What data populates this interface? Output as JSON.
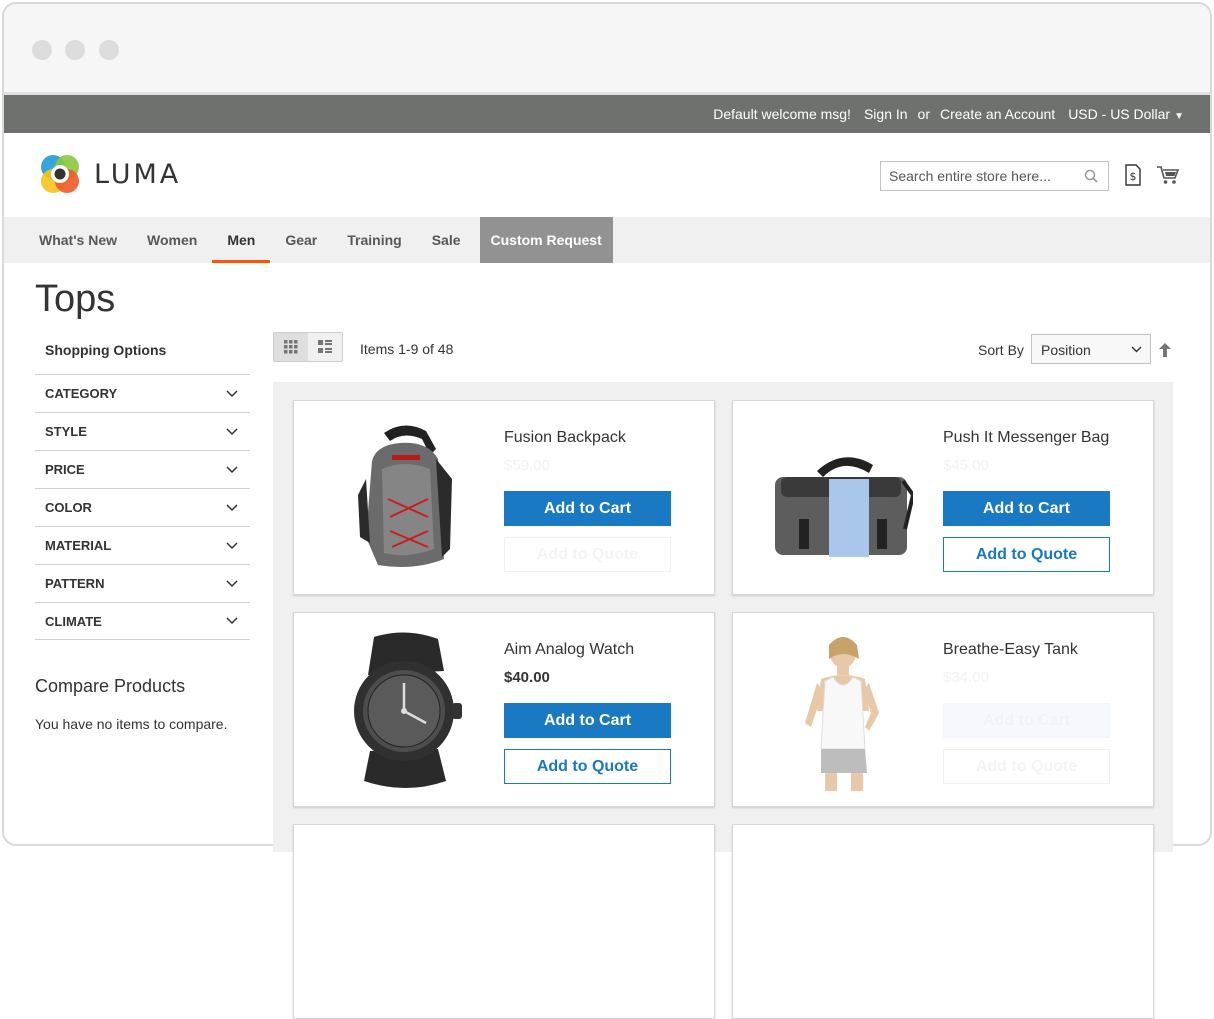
{
  "topbar": {
    "welcome": "Default welcome msg!",
    "sign_in": "Sign In",
    "or": "or",
    "create_account": "Create an Account",
    "currency": "USD - US Dollar"
  },
  "header": {
    "logo_text": "LUMA",
    "search_placeholder": "Search entire store here...",
    "icons": [
      "search-icon",
      "quote-icon",
      "cart-icon"
    ]
  },
  "nav": {
    "items": [
      {
        "label": "What's New"
      },
      {
        "label": "Women"
      },
      {
        "label": "Men"
      },
      {
        "label": "Gear"
      },
      {
        "label": "Training"
      },
      {
        "label": "Sale"
      },
      {
        "label": "Custom Request"
      }
    ],
    "active": "Men",
    "accent_color": "#ff5501"
  },
  "page": {
    "title": "Tops"
  },
  "sidebar": {
    "shopping_options": "Shopping Options",
    "filters": [
      "CATEGORY",
      "STYLE",
      "PRICE",
      "COLOR",
      "MATERIAL",
      "PATTERN",
      "CLIMATE"
    ],
    "compare_title": "Compare Products",
    "compare_empty": "You have no items to compare."
  },
  "toolbar": {
    "amount": "Items 1-9 of 48",
    "sort_label": "Sort By",
    "sort_value": "Position",
    "view_modes": [
      "grid-mode-icon",
      "list-mode-icon"
    ],
    "active_mode": "grid"
  },
  "products": [
    {
      "name": "Fusion Backpack",
      "price": "$59.00",
      "add_to_cart": "Add to Cart",
      "add_to_quote": "Add to Quote"
    },
    {
      "name": "Push It Messenger Bag",
      "price": "$45.00",
      "add_to_cart": "Add to Cart",
      "add_to_quote": "Add to Quote"
    },
    {
      "name": "Aim Analog Watch",
      "price": "$40.00",
      "add_to_cart": "Add to Cart",
      "add_to_quote": "Add to Quote"
    },
    {
      "name": "Breathe-Easy Tank",
      "price": "$34.00",
      "add_to_cart": "Add to Cart",
      "add_to_quote": "Add to Quote"
    }
  ],
  "colors": {
    "primary_button": "#1979c3",
    "topbar_bg": "#6e716e",
    "nav_bg": "#f0f0f0"
  }
}
